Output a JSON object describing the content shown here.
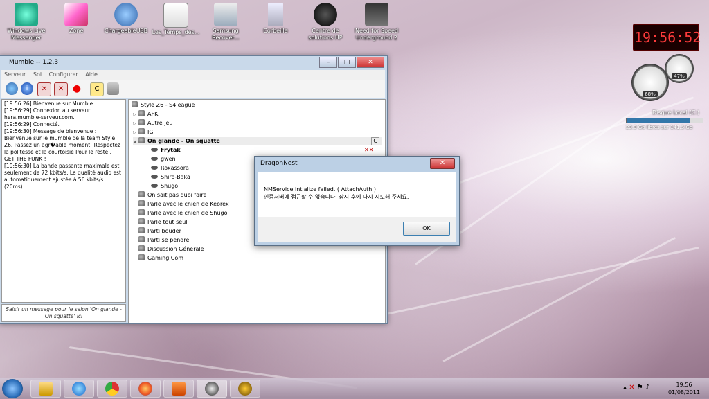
{
  "desktop": {
    "icons": [
      {
        "label": "Windows Live Messenger"
      },
      {
        "label": "Zone"
      },
      {
        "label": "ChargeableUSB"
      },
      {
        "label": "Les_Temps_des..."
      },
      {
        "label": "Samsung Recover..."
      },
      {
        "label": "Corbeille"
      },
      {
        "label": "Centre de solutions HP"
      },
      {
        "label": "Need for Speed Underground 2"
      }
    ],
    "clock_gadget": "19:56:52",
    "gauge_cpu": "68%",
    "gauge_mem": "47%",
    "disk": {
      "title": "Disque Local (C:)",
      "info": "23.3 Go libres sur 141.5 Go",
      "used_fraction": 0.84
    }
  },
  "mumble": {
    "title": "Mumble -- 1.2.3",
    "menu": [
      "Serveur",
      "Soi",
      "Configurer",
      "Aide"
    ],
    "log": [
      "[19:56:26] Bienvenue sur Mumble.",
      "[19:56:29] Connexion au serveur hera.mumble-serveur.com.",
      "[19:56:29] Connecté.",
      "[19:56:30] Message de bienvenue : Bienvenue sur le mumble de la team Style Z6. Passez un agr�able moment! Respectez la politesse et la courtoisie Pour le reste.. GET THE FUNK !",
      "[19:56:30] La bande passante maximale est seulement de 72 kbits/s. La qualité audio est automatiquement ajustée à 56 kbits/s (20ms)"
    ],
    "chat_placeholder": "Saisir un message pour le salon 'On glande - On squatte' ici",
    "tree": {
      "root": "Style Z6 - S4league",
      "channels_top": [
        "AFK",
        "Autre jeu",
        "IG"
      ],
      "active_channel": "On glande - On squatte",
      "users": [
        "Frytak",
        "gwen",
        "Roxassora",
        "Shiro-Baka",
        "Shugo"
      ],
      "channels_bottom": [
        "On sait pas quoi faire",
        "Parle avec le chien de Keorex",
        "Parle avec le chien de Shugo",
        "Parle tout seul",
        "Parti bouder",
        "Parti se pendre",
        "Discussion Générale",
        "Gaming Com"
      ]
    }
  },
  "dialog": {
    "title": "DragonNest",
    "line1": "NMService intialize failed. ( AttachAuth )",
    "line2": "인증서버에 접근할 수 없습니다. 잠시 후에 다시 시도해 주세요.",
    "ok_label": "OK"
  },
  "taskbar": {
    "time": "19:56",
    "date": "01/08/2011"
  }
}
